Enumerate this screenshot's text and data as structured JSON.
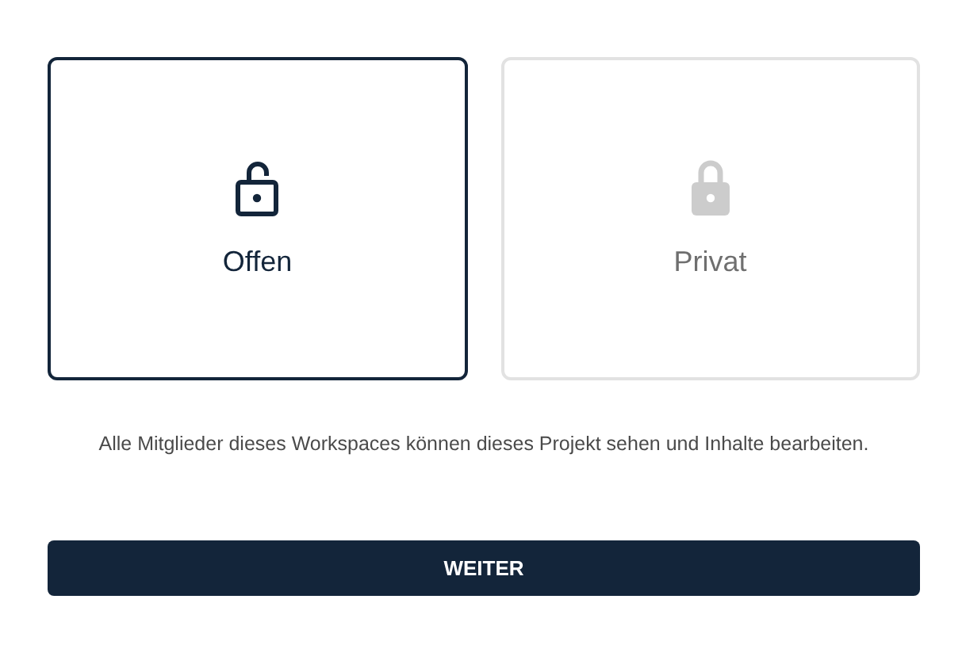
{
  "options": [
    {
      "label": "Offen",
      "kind": "open",
      "selected": true
    },
    {
      "label": "Privat",
      "kind": "closed",
      "selected": false
    }
  ],
  "description": "Alle Mitglieder dieses Workspaces können dieses Projekt sehen und Inhalte bearbeiten.",
  "button": "WEITER"
}
